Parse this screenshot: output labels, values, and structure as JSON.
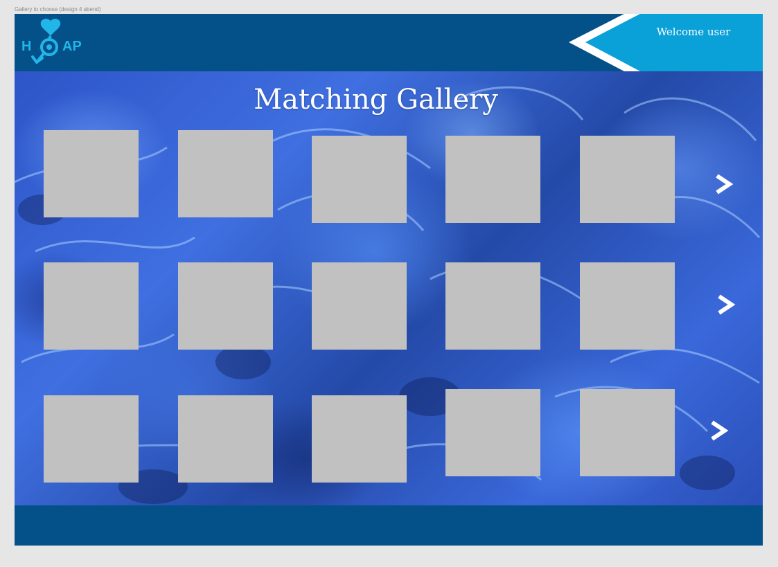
{
  "frame_label": "Gallery to choose (design 4 abend)",
  "header": {
    "logo": {
      "letter_left": "H",
      "letters_right": "AP"
    },
    "welcome_text": "Welcome user"
  },
  "main": {
    "title": "Matching Gallery",
    "rows": [
      {
        "tiles": 5,
        "next_label": ">"
      },
      {
        "tiles": 5,
        "next_label": ">"
      },
      {
        "tiles": 5,
        "next_label": ">"
      }
    ]
  },
  "colors": {
    "header_bg": "#045088",
    "welcome_bg": "#0aa0d8",
    "tile_bg": "#c1c1c1",
    "logo_blue": "#22b5e8"
  },
  "icons": {
    "logo": "heart-key-logo-icon",
    "next": "chevron-right-icon"
  }
}
